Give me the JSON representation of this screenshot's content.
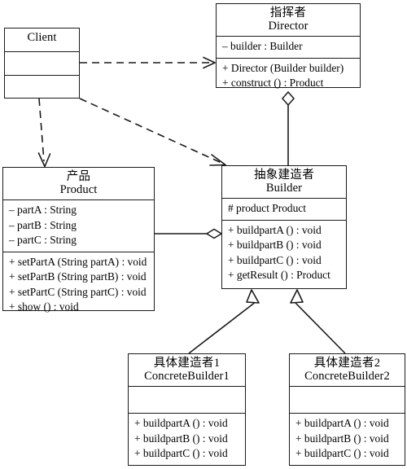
{
  "diagram": {
    "title": "Builder Pattern UML Class Diagram",
    "stroke_color": "#1a1a1a",
    "background_color": "#ffffff",
    "classes": [
      {
        "id": "client",
        "name_cn": "",
        "name_en": "Client",
        "attributes": [],
        "operations": []
      },
      {
        "id": "director",
        "name_cn": "指挥者",
        "name_en": "Director",
        "attributes": [
          "– builder : Builder"
        ],
        "operations": [
          "+ Director (Builder builder)",
          "+ construct () : Product"
        ]
      },
      {
        "id": "product",
        "name_cn": "产品",
        "name_en": "Product",
        "attributes": [
          "– partA : String",
          "– partB : String",
          "– partC : String"
        ],
        "operations": [
          "+ setPartA (String partA) : void",
          "+ setPartB (String partB) : void",
          "+ setPartC (String partC) : void",
          "+ show () : void"
        ]
      },
      {
        "id": "builder",
        "name_cn": "抽象建造者",
        "name_en": "Builder",
        "attributes": [
          "# product Product"
        ],
        "operations": [
          "+ buildpartA () : void",
          "+ buildpartB () : void",
          "+ buildpartC () : void",
          "+ getResult () : Product"
        ]
      },
      {
        "id": "concrete-builder-1",
        "name_cn": "具体建造者1",
        "name_en": "ConcreteBuilder1",
        "attributes": [],
        "operations": [
          "+ buildpartA () : void",
          "+ buildpartB () : void",
          "+ buildpartC () : void"
        ]
      },
      {
        "id": "concrete-builder-2",
        "name_cn": "具体建造者2",
        "name_en": "ConcreteBuilder2",
        "attributes": [],
        "operations": [
          "+ buildpartA () : void",
          "+ buildpartB () : void",
          "+ buildpartC () : void"
        ]
      }
    ],
    "relations": [
      {
        "id": "client-director",
        "type": "dependency",
        "from": "client",
        "to": "director",
        "style": "dashed",
        "head": "open-arrow"
      },
      {
        "id": "client-product",
        "type": "dependency",
        "from": "client",
        "to": "product",
        "style": "dashed",
        "head": "open-arrow"
      },
      {
        "id": "client-builder",
        "type": "dependency",
        "from": "client",
        "to": "builder",
        "style": "dashed",
        "head": "open-arrow"
      },
      {
        "id": "director-builder",
        "type": "aggregation",
        "from": "director",
        "to": "builder",
        "style": "solid",
        "head": "hollow-diamond"
      },
      {
        "id": "builder-product",
        "type": "aggregation",
        "from": "builder",
        "to": "product",
        "style": "solid",
        "head": "hollow-diamond"
      },
      {
        "id": "cb1-builder",
        "type": "generalization",
        "from": "concrete-builder-1",
        "to": "builder",
        "style": "solid",
        "head": "hollow-triangle"
      },
      {
        "id": "cb2-builder",
        "type": "generalization",
        "from": "concrete-builder-2",
        "to": "builder",
        "style": "solid",
        "head": "hollow-triangle"
      }
    ]
  }
}
